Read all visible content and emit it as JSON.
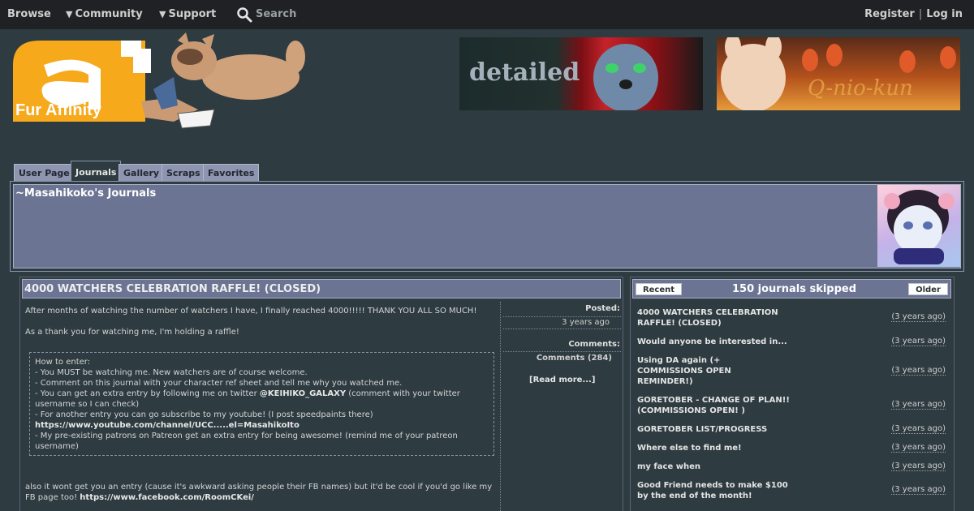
{
  "nav": {
    "browse": "Browse",
    "community": "Community",
    "support": "Support",
    "search": "Search",
    "register": "Register",
    "separator": "|",
    "login": "Log in"
  },
  "logo": {
    "text": "Fur Affinity"
  },
  "banners": [
    {
      "text": "detailed"
    },
    {
      "text": "Q-nio-kun"
    }
  ],
  "tabs": [
    {
      "label": "User Page"
    },
    {
      "label": "Journals",
      "active": true
    },
    {
      "label": "Gallery"
    },
    {
      "label": "Scraps"
    },
    {
      "label": "Favorites"
    }
  ],
  "header": {
    "title": "~Masahikoko's Journals"
  },
  "journal": {
    "title": "4000 WATCHERS CELEBRATION RAFFLE! (CLOSED)",
    "para1": "After months of watching the number of watchers I have, I finally reached 4000!!!!! THANK YOU ALL SO MUCH!",
    "para2": "As a thank you for watching me, I'm holding a raffle!",
    "howto": {
      "heading": "How to enter:",
      "line1": "- You MUST be watching me. New watchers are of course welcome.",
      "line2": "- Comment on this journal with your character ref sheet and tell me why you watched me.",
      "line3a": "- You can get an extra entry by following me on twitter ",
      "line3_handle": "@KEIHIKO_GALAXY",
      "line3b": " (comment with your twitter username so I can check)",
      "line4": "- For another entry you can go subscribe to my youtube! (I post speedpaints there)",
      "youtube_link": "https://www.youtube.com/channel/UCC.....el=MasahikoIto",
      "line5": "- My pre-existing patrons on Patreon get an extra entry for being awesome! (remind me of your patreon username)"
    },
    "para3": "also it wont get you an entry (cause it's awkward asking people their FB names) but it'd be cool if you'd go like my FB page too! ",
    "facebook_link": "https://www.facebook.com/RoomCKei/",
    "posted_label": "Posted:",
    "posted_value": "3 years ago",
    "comments_label": "Comments:",
    "comments_value": "Comments (284)",
    "read_more": "[Read more...]"
  },
  "journal_list": {
    "recent_btn": "Recent",
    "older_btn": "Older",
    "title": "150 journals skipped",
    "items": [
      {
        "title": "4000 WATCHERS CELEBRATION RAFFLE! (CLOSED)",
        "date": "(3 years ago)"
      },
      {
        "title": "Would anyone be interested in...",
        "date": "(3 years ago)"
      },
      {
        "title": "Using DA again (+ COMMISSIONS OPEN REMINDER!)",
        "date": "(3 years ago)"
      },
      {
        "title": "GORETOBER - CHANGE OF PLAN!! (COMMISSIONS OPEN! )",
        "date": "(3 years ago)"
      },
      {
        "title": "GORETOBER LIST/PROGRESS",
        "date": "(3 years ago)"
      },
      {
        "title": "Where else to find me!",
        "date": "(3 years ago)"
      },
      {
        "title": "my face when",
        "date": "(3 years ago)"
      },
      {
        "title": "Good Friend needs to make $100 by the end of the month!",
        "date": "(3 years ago)"
      }
    ]
  },
  "colors": {
    "page_bg": "#2e3b41",
    "nav_bg": "#1f2124",
    "panel_bg": "#6c7493",
    "tab_bg": "#8d95b1",
    "logo_orange": "#f6a91b"
  }
}
